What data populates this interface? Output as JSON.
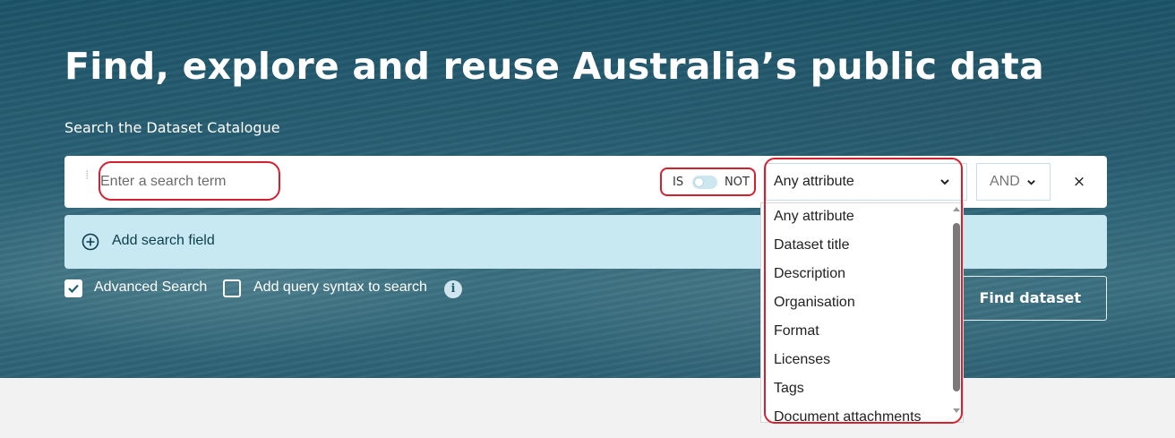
{
  "hero": {
    "title": "Find, explore and reuse Australia’s public data",
    "subtitle": "Search the Dataset Catalogue"
  },
  "search": {
    "placeholder": "Enter a search term",
    "value": "",
    "toggle": {
      "is_label": "IS",
      "not_label": "NOT",
      "state": "IS"
    },
    "attribute_select": {
      "selected": "Any attribute"
    },
    "operator_select": {
      "selected": "AND"
    },
    "clear_label": "×",
    "add_field_label": "Add search field"
  },
  "options": {
    "advanced_search_label": "Advanced Search",
    "advanced_search_checked": true,
    "query_syntax_label": "Add query syntax to search",
    "query_syntax_checked": false,
    "info_icon": "i",
    "find_button_label": "Find dataset"
  },
  "dropdown": {
    "items": [
      "Any attribute",
      "Dataset title",
      "Description",
      "Organisation",
      "Format",
      "Licenses",
      "Tags",
      "Document attachments"
    ]
  },
  "colors": {
    "hero_bg": "#2a6075",
    "add_row_bg": "#c9e9f2",
    "highlight": "#d4202f",
    "page_bg": "#f2f2f2"
  }
}
